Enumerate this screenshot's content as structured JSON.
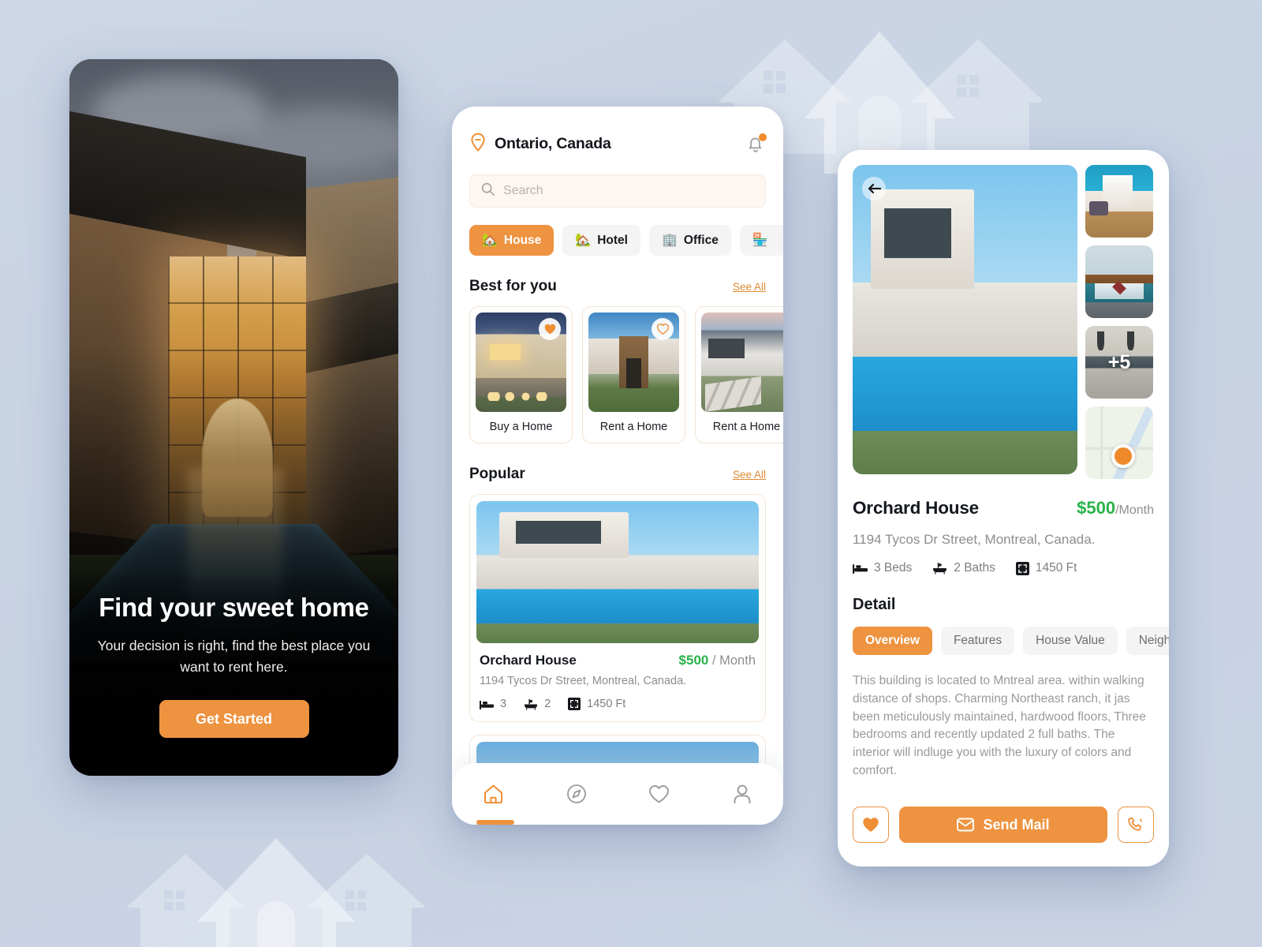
{
  "theme": {
    "background": "#c8d3e4",
    "accent": "#ee9340",
    "price_green": "#29b34a",
    "text_dark": "#14171d",
    "text_muted": "#8d8d8d"
  },
  "onboarding": {
    "title": "Find your sweet home",
    "subtitle": "Your decision is right, find the best place you want to rent here.",
    "cta_label": "Get Started"
  },
  "home": {
    "location": "Ontario, Canada",
    "location_icon": "map-pin-icon",
    "notification_icon": "bell-icon",
    "search": {
      "placeholder": "Search",
      "value": "",
      "icon": "search-icon"
    },
    "categories": [
      {
        "label": "House",
        "emoji": "🏡",
        "active": true
      },
      {
        "label": "Hotel",
        "emoji": "🏡",
        "active": false
      },
      {
        "label": "Office",
        "emoji": "🏢",
        "active": false
      },
      {
        "label": "",
        "emoji": "🏪",
        "active": false
      }
    ],
    "best_for_you": {
      "title": "Best for you",
      "see_all": "See All",
      "cards": [
        {
          "label": "Buy a Home",
          "favorited": true,
          "photo": "house-beige"
        },
        {
          "label": "Rent a Home",
          "favorited": false,
          "photo": "house-blue"
        },
        {
          "label": "Rent a Home",
          "favorited": false,
          "photo": "house-grey"
        }
      ]
    },
    "popular": {
      "title": "Popular",
      "see_all": "See All",
      "listings": [
        {
          "name": "Orchard House",
          "price": "$500",
          "price_unit": "/ Month",
          "address": "1194 Tycos Dr Street, Montreal, Canada.",
          "beds": "3",
          "baths": "2",
          "area": "1450 Ft",
          "photo": "modern-pool-house"
        },
        {
          "name": "",
          "photo": "suburb-house"
        }
      ]
    },
    "bottom_nav": [
      {
        "icon": "home-icon",
        "active": true
      },
      {
        "icon": "compass-icon",
        "active": false
      },
      {
        "icon": "heart-icon",
        "active": false
      },
      {
        "icon": "person-icon",
        "active": false
      }
    ]
  },
  "detail": {
    "back_icon": "arrow-left-icon",
    "hero_photo": "modern-pool-house",
    "thumbnails": [
      {
        "photo": "living-room",
        "overlay": ""
      },
      {
        "photo": "bedroom",
        "overlay": ""
      },
      {
        "photo": "kitchen",
        "overlay": "+5"
      },
      {
        "photo": "map",
        "overlay": ""
      }
    ],
    "name": "Orchard House",
    "price": "$500",
    "price_unit": "/Month",
    "address": "1194 Tycos Dr Street, Montreal, Canada.",
    "beds": "3 Beds",
    "baths": "2 Baths",
    "area": "1450 Ft",
    "detail_heading": "Detail",
    "tabs": [
      {
        "label": "Overview",
        "active": true
      },
      {
        "label": "Features",
        "active": false
      },
      {
        "label": "House Value",
        "active": false
      },
      {
        "label": "Neighb",
        "active": false
      }
    ],
    "description": "This building is located to Mntreal area. within walking distance of shops. Charming Northeast ranch, it jas been meticulously maintained, hardwood floors, Three bedrooms and recently updated 2 full baths. The interior will indluge you with the luxury of colors and comfort.",
    "actions": {
      "favorite_icon": "heart-filled-icon",
      "send_mail_label": "Send Mail",
      "send_mail_icon": "envelope-icon",
      "call_icon": "phone-icon"
    }
  }
}
